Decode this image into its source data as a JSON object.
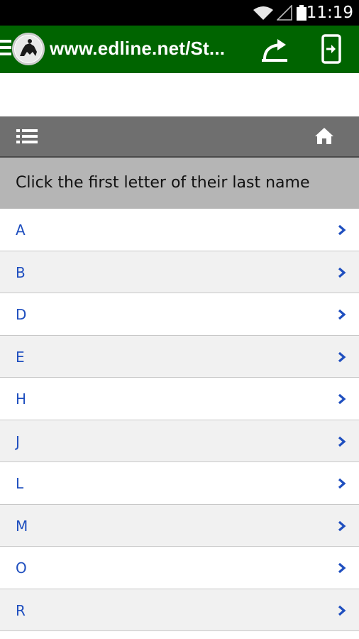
{
  "status_bar": {
    "time": "11:19"
  },
  "app_bar": {
    "url": "www.edline.net/St..."
  },
  "page": {
    "instructions": "Click the first letter of their last name"
  },
  "letters": [
    "A",
    "B",
    "D",
    "E",
    "H",
    "J",
    "L",
    "M",
    "O",
    "R"
  ],
  "colors": {
    "brand_green": "#006400",
    "link_blue": "#1f4fbf",
    "toolbar_gray": "#6f6f6f"
  }
}
